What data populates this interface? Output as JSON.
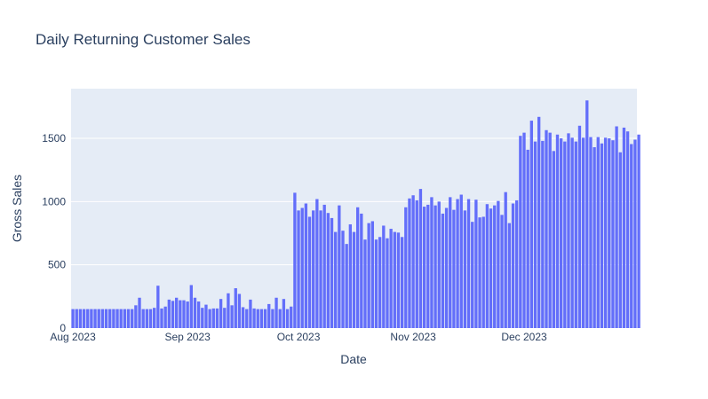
{
  "chart_data": {
    "type": "bar",
    "title": "Daily Returning Customer Sales",
    "xlabel": "Date",
    "ylabel": "Gross Sales",
    "x_range": [
      "2023-07-31T12:00",
      "2023-12-31T12:00"
    ],
    "ylim": [
      0,
      1893
    ],
    "y_ticks": [
      0,
      500,
      1000,
      1500
    ],
    "x_ticks": [
      {
        "date": "2023-08-01",
        "label": "Aug 2023"
      },
      {
        "date": "2023-09-01",
        "label": "Sep 2023"
      },
      {
        "date": "2023-10-01",
        "label": "Oct 2023"
      },
      {
        "date": "2023-11-01",
        "label": "Nov 2023"
      },
      {
        "date": "2023-12-01",
        "label": "Dec 2023"
      }
    ],
    "grid": true,
    "bar_color": "#636efa",
    "plot_background": "#e5ecf6",
    "start_date": "2023-08-01",
    "values": [
      150,
      150,
      150,
      150,
      150,
      150,
      150,
      150,
      150,
      150,
      150,
      150,
      150,
      150,
      150,
      150,
      150,
      180,
      240,
      150,
      150,
      150,
      160,
      335,
      155,
      170,
      225,
      215,
      240,
      220,
      220,
      210,
      340,
      240,
      210,
      160,
      185,
      150,
      155,
      155,
      230,
      160,
      275,
      180,
      315,
      270,
      165,
      150,
      225,
      155,
      150,
      150,
      150,
      190,
      150,
      240,
      150,
      230,
      150,
      170,
      1070,
      930,
      950,
      985,
      880,
      930,
      1020,
      930,
      975,
      910,
      870,
      760,
      970,
      770,
      665,
      820,
      760,
      955,
      905,
      700,
      830,
      845,
      700,
      720,
      810,
      710,
      785,
      760,
      755,
      720,
      955,
      1025,
      1050,
      1010,
      1100,
      960,
      975,
      1035,
      970,
      1000,
      905,
      950,
      1035,
      935,
      1020,
      1055,
      930,
      1020,
      840,
      1015,
      875,
      880,
      980,
      945,
      970,
      1005,
      895,
      1075,
      830,
      985,
      1010,
      1520,
      1545,
      1410,
      1640,
      1475,
      1670,
      1480,
      1565,
      1545,
      1400,
      1530,
      1500,
      1475,
      1540,
      1505,
      1475,
      1600,
      1505,
      1800,
      1510,
      1430,
      1510,
      1460,
      1505,
      1500,
      1485,
      1595,
      1390,
      1585,
      1555,
      1455,
      1490,
      1530
    ]
  }
}
